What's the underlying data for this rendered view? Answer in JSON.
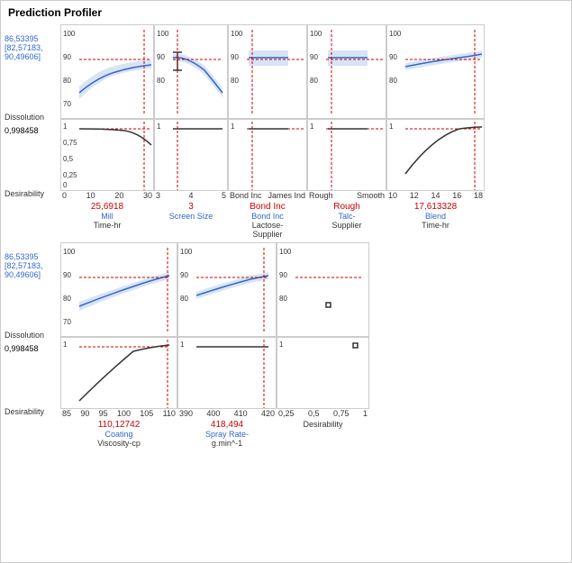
{
  "title": "Prediction Profiler",
  "section1": {
    "yLabels": [
      {
        "main": "86,53395",
        "sub": "[82,57183,",
        "sub2": "90,49606]",
        "axis": "Dissolution"
      },
      {
        "main": "0,998458",
        "axis": "Desirability",
        "ticks": [
          "1",
          "0,75",
          "0,5",
          "0,25",
          "0"
        ]
      }
    ],
    "plots": [
      {
        "xLabel": "Mill\nTime-hr",
        "xTicks": [
          "0",
          "10",
          "20",
          "30"
        ],
        "value": "25,6918",
        "valueLabel": "Mill",
        "valueSub": "Time-hr"
      },
      {
        "xLabel": "Screen Size",
        "xTicks": [
          "3",
          "4",
          "5"
        ],
        "value": "3",
        "valueLabel": "Screen Size",
        "valueSub": ""
      },
      {
        "xLabel": "Bond Inc\nLactose-\nSupplier",
        "xTicks": [
          "Bond Inc",
          "James Ind"
        ],
        "value": "Bond Inc",
        "valueLabel": "Bond Inc",
        "valueSub": "Lactose-\nSupplier"
      },
      {
        "xLabel": "Talc-\nSupplier",
        "xTicks": [
          "Rough",
          "Smooth"
        ],
        "value": "Rough",
        "valueLabel": "Rough",
        "valueSub": "Talc-\nSupplier"
      },
      {
        "xLabel": "Blend\nTime-hr",
        "xTicks": [
          "10",
          "12",
          "14",
          "16",
          "18"
        ],
        "value": "17,613328",
        "valueLabel": "Blend",
        "valueSub": "Time-hr"
      }
    ]
  },
  "section2": {
    "yLabels": [
      {
        "main": "86,53395",
        "sub": "[82,57183,",
        "sub2": "90,49606]",
        "axis": "Dissolution"
      },
      {
        "main": "0,998458",
        "axis": "Desirability"
      }
    ],
    "plots": [
      {
        "xLabel": "Coating\nViscosity-cp",
        "xTicks": [
          "85",
          "90",
          "95",
          "100",
          "105",
          "110"
        ],
        "value": "110,12742",
        "valueLabel": "Coating",
        "valueSub": "Viscosity-cp"
      },
      {
        "xLabel": "Spray Rate-\ng.min^-1",
        "xTicks": [
          "390",
          "400",
          "410",
          "420"
        ],
        "value": "418,494",
        "valueLabel": "Spray Rate-",
        "valueSub": "g.min^-1"
      },
      {
        "xLabel": "Desirability",
        "xTicks": [
          "0.25",
          "0.5",
          "0.75",
          "1"
        ],
        "value": "",
        "valueLabel": "Desirability",
        "valueSub": ""
      }
    ]
  }
}
